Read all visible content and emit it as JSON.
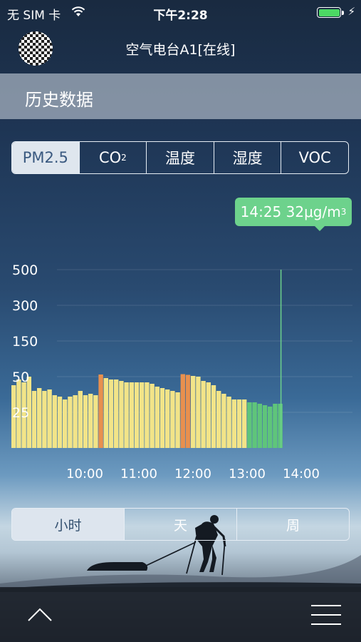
{
  "status_bar": {
    "carrier": "无 SIM 卡",
    "time": "下午2:28",
    "battery_color": "#4cd964"
  },
  "header": {
    "title": "空气电台A1[在线]"
  },
  "section": {
    "title": "历史数据"
  },
  "metric_tabs": [
    {
      "label": "PM2.5",
      "active": true
    },
    {
      "label": "CO",
      "sub": "2",
      "active": false
    },
    {
      "label": "温度",
      "active": false
    },
    {
      "label": "湿度",
      "active": false
    },
    {
      "label": "VOC",
      "active": false
    }
  ],
  "tooltip": {
    "text": "14:25 32μg/m",
    "sup": "3",
    "color": "#6dd28c"
  },
  "range_tabs": [
    {
      "label": "小时",
      "active": true
    },
    {
      "label": "天",
      "active": false
    },
    {
      "label": "周",
      "active": false
    }
  ],
  "icons": {
    "footer_left": "chevron-up-icon",
    "footer_right": "menu-icon"
  },
  "chart_data": {
    "type": "bar",
    "y_tick_labels": [
      "500",
      "300",
      "150",
      "50",
      "25"
    ],
    "x_tick_labels": [
      "10:00",
      "11:00",
      "12:00",
      "13:00",
      "14:00"
    ],
    "colors": {
      "good": "#f2e488",
      "moderate": "#e8904e",
      "excellent": "#5fc57a",
      "cursor": "#6dd28c"
    },
    "bars": [
      {
        "v": 44,
        "c": "good"
      },
      {
        "v": 48,
        "c": "good"
      },
      {
        "v": 46,
        "c": "good"
      },
      {
        "v": 50,
        "c": "good"
      },
      {
        "v": 40,
        "c": "good"
      },
      {
        "v": 42,
        "c": "good"
      },
      {
        "v": 40,
        "c": "good"
      },
      {
        "v": 41,
        "c": "good"
      },
      {
        "v": 37,
        "c": "good"
      },
      {
        "v": 36,
        "c": "good"
      },
      {
        "v": 34,
        "c": "good"
      },
      {
        "v": 36,
        "c": "good"
      },
      {
        "v": 37,
        "c": "good"
      },
      {
        "v": 40,
        "c": "good"
      },
      {
        "v": 37,
        "c": "good"
      },
      {
        "v": 38,
        "c": "good"
      },
      {
        "v": 37,
        "c": "good"
      },
      {
        "v": 56,
        "c": "moderate"
      },
      {
        "v": 49,
        "c": "good"
      },
      {
        "v": 48,
        "c": "good"
      },
      {
        "v": 48,
        "c": "good"
      },
      {
        "v": 47,
        "c": "good"
      },
      {
        "v": 46,
        "c": "good"
      },
      {
        "v": 46,
        "c": "good"
      },
      {
        "v": 46,
        "c": "good"
      },
      {
        "v": 46,
        "c": "good"
      },
      {
        "v": 46,
        "c": "good"
      },
      {
        "v": 45,
        "c": "good"
      },
      {
        "v": 43,
        "c": "good"
      },
      {
        "v": 42,
        "c": "good"
      },
      {
        "v": 41,
        "c": "good"
      },
      {
        "v": 40,
        "c": "good"
      },
      {
        "v": 39,
        "c": "good"
      },
      {
        "v": 57,
        "c": "moderate"
      },
      {
        "v": 55,
        "c": "moderate"
      },
      {
        "v": 52,
        "c": "good"
      },
      {
        "v": 50,
        "c": "good"
      },
      {
        "v": 47,
        "c": "good"
      },
      {
        "v": 46,
        "c": "good"
      },
      {
        "v": 44,
        "c": "good"
      },
      {
        "v": 40,
        "c": "good"
      },
      {
        "v": 38,
        "c": "good"
      },
      {
        "v": 36,
        "c": "good"
      },
      {
        "v": 34,
        "c": "good"
      },
      {
        "v": 34,
        "c": "good"
      },
      {
        "v": 34,
        "c": "good"
      },
      {
        "v": 32,
        "c": "excellent"
      },
      {
        "v": 32,
        "c": "excellent"
      },
      {
        "v": 31,
        "c": "excellent"
      },
      {
        "v": 30,
        "c": "excellent"
      },
      {
        "v": 29,
        "c": "excellent"
      },
      {
        "v": 31,
        "c": "excellent"
      },
      {
        "v": 31,
        "c": "excellent"
      }
    ]
  }
}
